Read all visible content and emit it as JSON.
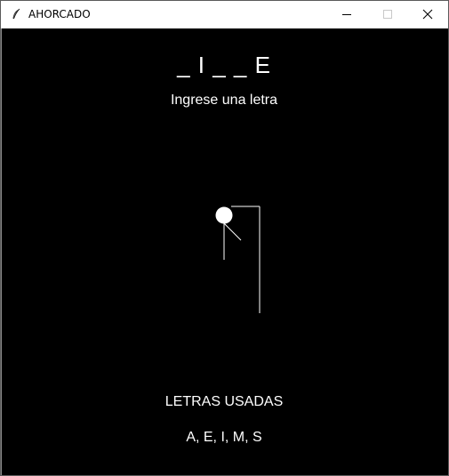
{
  "window": {
    "title": "AHORCADO"
  },
  "game": {
    "word_display": "_ I _ _ E",
    "prompt": "Ingrese una letra",
    "used_title": "LETRAS USADAS",
    "used_letters": "A, E, I, M, S"
  },
  "colors": {
    "canvas_background": "#000000",
    "foreground": "#ffffff"
  },
  "icons": {
    "app": "feather-icon",
    "minimize": "minimize-icon",
    "maximize": "maximize-icon",
    "close": "close-icon"
  }
}
